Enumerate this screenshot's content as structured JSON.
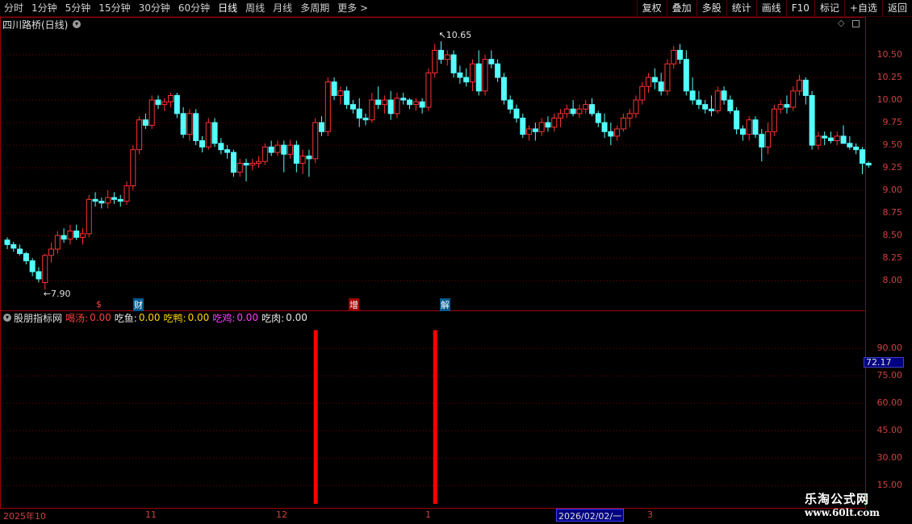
{
  "toolbar": {
    "periods": [
      "分时",
      "1分钟",
      "5分钟",
      "15分钟",
      "30分钟",
      "60分钟",
      "日线",
      "周线",
      "月线",
      "多周期",
      "更多 >"
    ],
    "active_period": "日线",
    "actions": [
      "复权",
      "叠加",
      "多股",
      "统计",
      "画线",
      "F10",
      "标记",
      "+自选",
      "返回"
    ]
  },
  "stock": {
    "title": "四川路桥(日线)"
  },
  "price_chart": {
    "y_labels": [
      "10.50",
      "10.25",
      "10.00",
      "9.75",
      "9.50",
      "9.25",
      "9.00",
      "8.75",
      "8.50",
      "8.25",
      "8.00"
    ],
    "high_label": "10.65",
    "low_label": "7.90",
    "markers": [
      "$",
      "财",
      "增",
      "解"
    ]
  },
  "indicator": {
    "name": "股朋指标网",
    "items": [
      {
        "label": "喝汤:",
        "value": "0.00"
      },
      {
        "label": "吃鱼:",
        "value": "0.00"
      },
      {
        "label": "吃鸭:",
        "value": "0.00"
      },
      {
        "label": "吃鸡:",
        "value": "0.00"
      },
      {
        "label": "吃肉:",
        "value": "0.00"
      }
    ],
    "y_labels": [
      "90.00",
      "75.00",
      "60.00",
      "45.00",
      "30.00",
      "15.00"
    ],
    "current_value": "72.17"
  },
  "date_axis": {
    "labels": [
      "2025年10",
      "11",
      "12",
      "1",
      "3"
    ],
    "cursor_date": "2026/02/02/一"
  },
  "watermark": {
    "line1": "乐淘公式网",
    "line2": "www.60lt.com"
  },
  "colors": {
    "up": "#ff3232",
    "down": "#54ffff",
    "frame": "#a00000",
    "grid": "#7a0000",
    "bar": "#ff0000"
  },
  "chart_data": {
    "type": "candlestick",
    "ylim": [
      7.85,
      10.75
    ],
    "ohlc": [
      [
        8.45,
        8.48,
        8.35,
        8.4
      ],
      [
        8.4,
        8.43,
        8.32,
        8.36
      ],
      [
        8.35,
        8.4,
        8.28,
        8.3
      ],
      [
        8.3,
        8.32,
        8.18,
        8.22
      ],
      [
        8.22,
        8.25,
        8.05,
        8.1
      ],
      [
        8.1,
        8.15,
        7.98,
        8.02
      ],
      [
        7.98,
        8.3,
        7.9,
        8.28
      ],
      [
        8.28,
        8.42,
        8.2,
        8.35
      ],
      [
        8.35,
        8.55,
        8.3,
        8.5
      ],
      [
        8.5,
        8.58,
        8.42,
        8.46
      ],
      [
        8.46,
        8.62,
        8.4,
        8.55
      ],
      [
        8.55,
        8.62,
        8.45,
        8.48
      ],
      [
        8.48,
        8.58,
        8.4,
        8.52
      ],
      [
        8.52,
        8.95,
        8.48,
        8.9
      ],
      [
        8.9,
        8.98,
        8.82,
        8.88
      ],
      [
        8.88,
        8.92,
        8.8,
        8.86
      ],
      [
        8.86,
        9.0,
        8.8,
        8.92
      ],
      [
        8.92,
        8.98,
        8.85,
        8.9
      ],
      [
        8.9,
        8.95,
        8.82,
        8.88
      ],
      [
        8.88,
        9.1,
        8.84,
        9.05
      ],
      [
        9.05,
        9.5,
        9.0,
        9.45
      ],
      [
        9.45,
        9.82,
        9.4,
        9.78
      ],
      [
        9.78,
        9.85,
        9.68,
        9.72
      ],
      [
        9.72,
        10.05,
        9.68,
        10.0
      ],
      [
        10.0,
        10.05,
        9.9,
        9.95
      ],
      [
        9.95,
        10.02,
        9.88,
        9.98
      ],
      [
        9.98,
        10.08,
        9.92,
        10.05
      ],
      [
        10.05,
        10.08,
        9.8,
        9.85
      ],
      [
        9.85,
        9.92,
        9.58,
        9.62
      ],
      [
        9.62,
        9.9,
        9.55,
        9.85
      ],
      [
        9.85,
        9.9,
        9.5,
        9.55
      ],
      [
        9.55,
        9.6,
        9.42,
        9.48
      ],
      [
        9.48,
        9.8,
        9.45,
        9.75
      ],
      [
        9.75,
        9.8,
        9.48,
        9.52
      ],
      [
        9.52,
        9.58,
        9.4,
        9.45
      ],
      [
        9.45,
        9.5,
        9.35,
        9.42
      ],
      [
        9.42,
        9.45,
        9.15,
        9.2
      ],
      [
        9.2,
        9.35,
        9.15,
        9.3
      ],
      [
        9.3,
        9.35,
        9.1,
        9.28
      ],
      [
        9.28,
        9.35,
        9.22,
        9.3
      ],
      [
        9.3,
        9.38,
        9.25,
        9.32
      ],
      [
        9.32,
        9.52,
        9.28,
        9.48
      ],
      [
        9.48,
        9.55,
        9.38,
        9.42
      ],
      [
        9.42,
        9.55,
        9.38,
        9.5
      ],
      [
        9.5,
        9.55,
        9.2,
        9.4
      ],
      [
        9.4,
        9.56,
        9.35,
        9.5
      ],
      [
        9.5,
        9.55,
        9.2,
        9.3
      ],
      [
        9.3,
        9.45,
        9.18,
        9.38
      ],
      [
        9.38,
        9.45,
        9.15,
        9.35
      ],
      [
        9.35,
        9.8,
        9.3,
        9.75
      ],
      [
        9.75,
        9.82,
        9.6,
        9.65
      ],
      [
        9.65,
        10.25,
        9.6,
        10.2
      ],
      [
        10.2,
        10.25,
        10.0,
        10.05
      ],
      [
        10.05,
        10.15,
        9.95,
        10.1
      ],
      [
        10.1,
        10.15,
        9.9,
        9.95
      ],
      [
        9.95,
        10.0,
        9.85,
        9.9
      ],
      [
        9.9,
        10.02,
        9.7,
        9.8
      ],
      [
        9.8,
        9.85,
        9.72,
        9.78
      ],
      [
        9.78,
        10.08,
        9.75,
        10.0
      ],
      [
        10.0,
        10.15,
        9.9,
        9.95
      ],
      [
        9.95,
        10.05,
        9.85,
        10.0
      ],
      [
        10.0,
        10.1,
        9.78,
        9.85
      ],
      [
        9.85,
        10.08,
        9.8,
        10.02
      ],
      [
        10.02,
        10.08,
        9.95,
        10.0
      ],
      [
        10.0,
        10.02,
        9.9,
        9.95
      ],
      [
        9.95,
        10.02,
        9.88,
        9.98
      ],
      [
        9.98,
        10.02,
        9.85,
        9.92
      ],
      [
        9.92,
        10.35,
        9.88,
        10.3
      ],
      [
        10.3,
        10.62,
        10.25,
        10.55
      ],
      [
        10.55,
        10.65,
        10.4,
        10.45
      ],
      [
        10.45,
        10.55,
        10.38,
        10.5
      ],
      [
        10.5,
        10.55,
        10.25,
        10.3
      ],
      [
        10.3,
        10.38,
        10.18,
        10.25
      ],
      [
        10.25,
        10.35,
        10.15,
        10.2
      ],
      [
        10.2,
        10.45,
        10.1,
        10.4
      ],
      [
        10.4,
        10.55,
        10.05,
        10.1
      ],
      [
        10.1,
        10.5,
        10.05,
        10.45
      ],
      [
        10.45,
        10.55,
        10.35,
        10.4
      ],
      [
        10.4,
        10.45,
        10.2,
        10.25
      ],
      [
        10.25,
        10.3,
        9.95,
        10.0
      ],
      [
        10.0,
        10.05,
        9.85,
        9.9
      ],
      [
        9.9,
        9.95,
        9.75,
        9.8
      ],
      [
        9.8,
        9.85,
        9.58,
        9.62
      ],
      [
        9.62,
        9.72,
        9.55,
        9.68
      ],
      [
        9.68,
        9.75,
        9.55,
        9.65
      ],
      [
        9.65,
        9.8,
        9.6,
        9.75
      ],
      [
        9.75,
        9.82,
        9.65,
        9.7
      ],
      [
        9.7,
        9.85,
        9.65,
        9.8
      ],
      [
        9.8,
        9.9,
        9.7,
        9.85
      ],
      [
        9.85,
        9.95,
        9.8,
        9.9
      ],
      [
        9.9,
        10.0,
        9.82,
        9.85
      ],
      [
        9.85,
        9.95,
        9.8,
        9.9
      ],
      [
        9.9,
        10.0,
        9.85,
        9.95
      ],
      [
        9.95,
        10.02,
        9.82,
        9.85
      ],
      [
        9.85,
        9.88,
        9.7,
        9.75
      ],
      [
        9.75,
        9.85,
        9.58,
        9.65
      ],
      [
        9.65,
        9.75,
        9.5,
        9.6
      ],
      [
        9.6,
        9.72,
        9.55,
        9.68
      ],
      [
        9.68,
        9.85,
        9.65,
        9.8
      ],
      [
        9.8,
        9.9,
        9.7,
        9.85
      ],
      [
        9.85,
        10.05,
        9.8,
        10.0
      ],
      [
        10.0,
        10.2,
        9.95,
        10.15
      ],
      [
        10.15,
        10.3,
        10.08,
        10.25
      ],
      [
        10.25,
        10.35,
        10.12,
        10.2
      ],
      [
        10.2,
        10.3,
        10.05,
        10.1
      ],
      [
        10.1,
        10.45,
        10.05,
        10.4
      ],
      [
        10.4,
        10.6,
        10.35,
        10.55
      ],
      [
        10.55,
        10.62,
        10.4,
        10.45
      ],
      [
        10.45,
        10.55,
        10.05,
        10.1
      ],
      [
        10.1,
        10.25,
        9.95,
        10.0
      ],
      [
        10.0,
        10.1,
        9.9,
        9.95
      ],
      [
        9.95,
        10.0,
        9.85,
        9.9
      ],
      [
        9.9,
        10.05,
        9.82,
        9.88
      ],
      [
        9.88,
        10.15,
        9.85,
        10.1
      ],
      [
        10.1,
        10.15,
        9.95,
        10.0
      ],
      [
        10.0,
        10.05,
        9.85,
        9.88
      ],
      [
        9.88,
        9.92,
        9.62,
        9.68
      ],
      [
        9.68,
        9.72,
        9.55,
        9.62
      ],
      [
        9.62,
        9.82,
        9.55,
        9.78
      ],
      [
        9.78,
        9.82,
        9.58,
        9.62
      ],
      [
        9.62,
        9.68,
        9.32,
        9.48
      ],
      [
        9.48,
        9.75,
        9.4,
        9.65
      ],
      [
        9.65,
        9.95,
        9.6,
        9.9
      ],
      [
        9.9,
        10.0,
        9.85,
        9.95
      ],
      [
        9.95,
        10.05,
        9.85,
        9.92
      ],
      [
        9.92,
        10.15,
        9.88,
        10.1
      ],
      [
        10.1,
        10.28,
        10.05,
        10.22
      ],
      [
        10.22,
        10.25,
        9.95,
        10.05
      ],
      [
        10.05,
        10.1,
        9.45,
        9.5
      ],
      [
        9.5,
        9.65,
        9.45,
        9.6
      ],
      [
        9.6,
        9.65,
        9.5,
        9.58
      ],
      [
        9.58,
        9.65,
        9.52,
        9.55
      ],
      [
        9.55,
        9.65,
        9.5,
        9.6
      ],
      [
        9.6,
        9.72,
        9.55,
        9.52
      ],
      [
        9.52,
        9.6,
        9.45,
        9.48
      ],
      [
        9.48,
        9.52,
        9.4,
        9.45
      ],
      [
        9.45,
        9.48,
        9.18,
        9.3
      ],
      [
        9.3,
        9.32,
        9.25,
        9.28
      ]
    ],
    "indicator_bars": [
      {
        "index": 49,
        "value": 100
      },
      {
        "index": 68,
        "value": 100
      }
    ],
    "indicator_ylim": [
      5,
      102
    ]
  }
}
